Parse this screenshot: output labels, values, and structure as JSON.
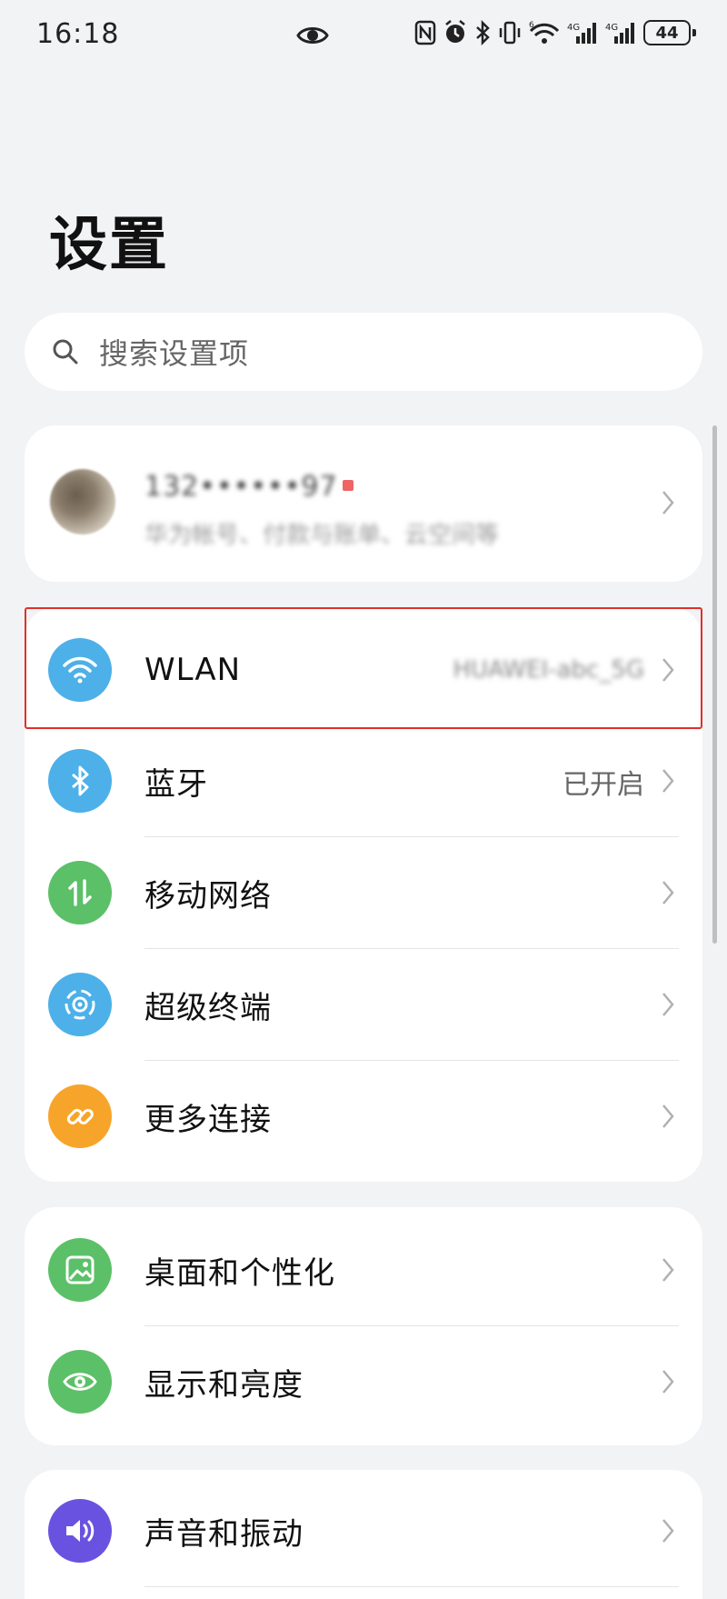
{
  "status_bar": {
    "time": "16:18",
    "battery": "44",
    "icons": [
      "eye-icon",
      "nfc-icon",
      "alarm-icon",
      "bluetooth-icon",
      "vibrate-icon",
      "wifi-6-icon",
      "signal-4g-icon",
      "signal-4g-icon",
      "battery-icon"
    ]
  },
  "title": "设置",
  "search": {
    "placeholder": "搜索设置项"
  },
  "account": {
    "name": "132••••••97",
    "subtitle": "华为帐号、付款与账单、云空间等"
  },
  "connections": [
    {
      "label": "WLAN",
      "value": "HUAWEI-abc_5G",
      "icon": "wifi-icon",
      "color": "#4db0e8",
      "highlighted": true
    },
    {
      "label": "蓝牙",
      "value": "已开启",
      "icon": "bluetooth-icon",
      "color": "#4db0e8"
    },
    {
      "label": "移动网络",
      "value": "",
      "icon": "mobile-data-icon",
      "color": "#5cc068"
    },
    {
      "label": "超级终端",
      "value": "",
      "icon": "super-device-icon",
      "color": "#4db0e8"
    },
    {
      "label": "更多连接",
      "value": "",
      "icon": "link-icon",
      "color": "#f7a52a"
    }
  ],
  "display": [
    {
      "label": "桌面和个性化",
      "icon": "image-icon",
      "color": "#5cc068"
    },
    {
      "label": "显示和亮度",
      "icon": "eye-icon",
      "color": "#5cc068"
    }
  ],
  "sound": [
    {
      "label": "声音和振动",
      "icon": "speaker-icon",
      "color": "#6a52e0"
    }
  ],
  "colors": {
    "highlight": "#e0302a",
    "background": "#f2f3f5"
  }
}
